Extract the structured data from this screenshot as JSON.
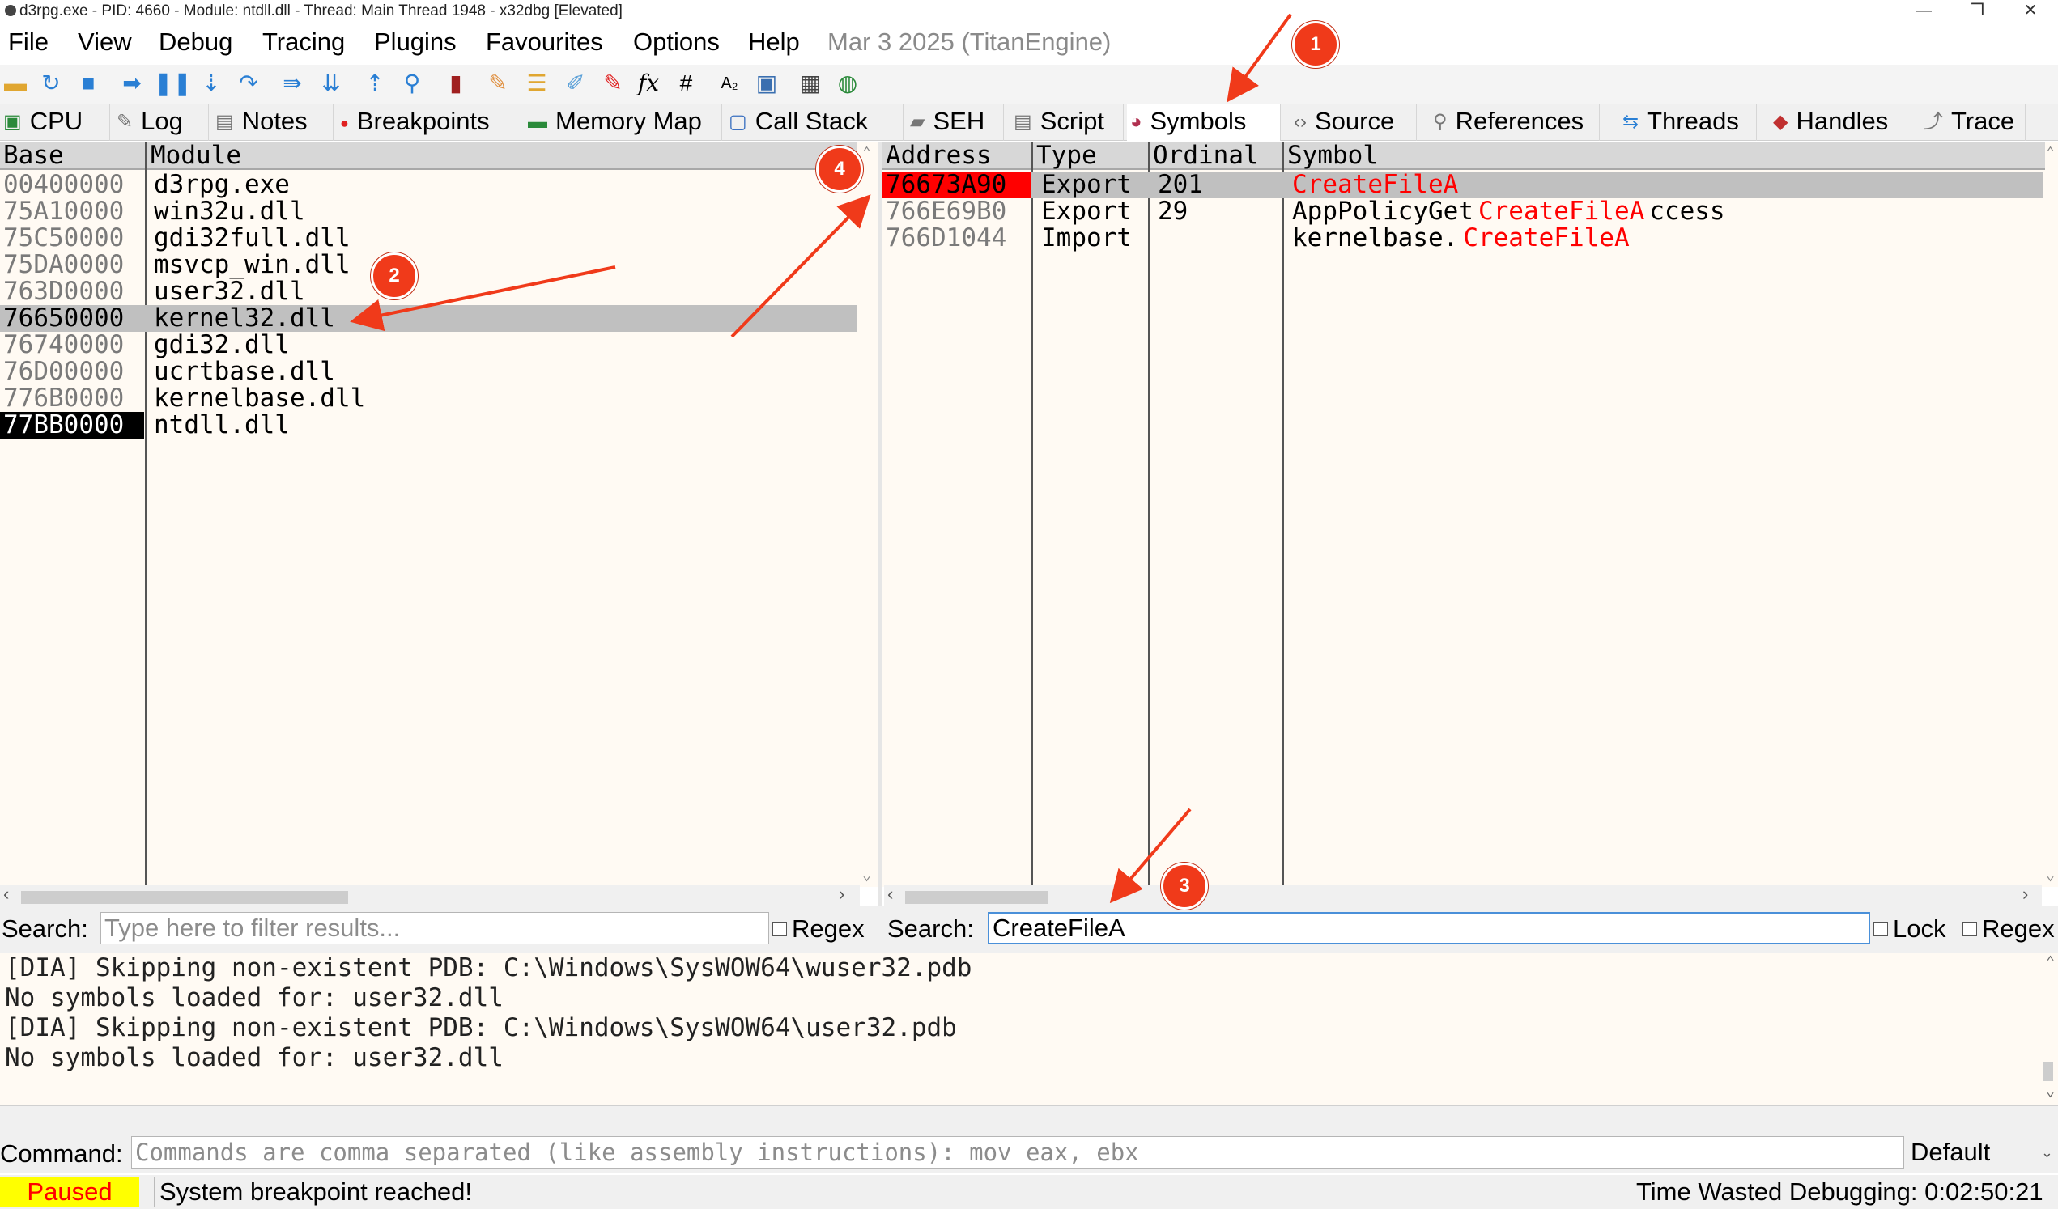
{
  "window": {
    "title": "d3rpg.exe - PID: 4660 - Module: ntdll.dll - Thread: Main Thread 1948 - x32dbg [Elevated]",
    "controls": {
      "minimize": "—",
      "restore": "❐",
      "close": "✕"
    }
  },
  "menu": {
    "items": [
      "File",
      "View",
      "Debug",
      "Tracing",
      "Plugins",
      "Favourites",
      "Options",
      "Help"
    ],
    "date": "Mar 3 2025 (TitanEngine)"
  },
  "toolbar": {
    "icons": [
      "open-icon",
      "restart-icon",
      "stop-icon",
      "run-icon",
      "pause-icon",
      "step-into-icon",
      "step-over-icon",
      "trace-into-icon",
      "trace-over-icon",
      "execute-till-return-icon",
      "run-to-user-code-icon",
      "scylla-icon",
      "patch-icon",
      "comments-icon",
      "labels-icon",
      "bookmarks-icon",
      "functions-icon",
      "hash-icon",
      "font-icon",
      "memory-icon",
      "calculator-icon",
      "globe-icon"
    ],
    "function_glyph": "fx",
    "hash_glyph": "#",
    "font_glyph": "A₂"
  },
  "tabs": [
    {
      "label": "CPU",
      "icon": "cpu-icon",
      "active": false
    },
    {
      "label": "Log",
      "icon": "log-icon",
      "active": false
    },
    {
      "label": "Notes",
      "icon": "notes-icon",
      "active": false
    },
    {
      "label": "Breakpoints",
      "icon": "breakpoint-dot-icon",
      "active": false
    },
    {
      "label": "Memory Map",
      "icon": "memory-map-icon",
      "active": false
    },
    {
      "label": "Call Stack",
      "icon": "call-stack-icon",
      "active": false
    },
    {
      "label": "SEH",
      "icon": "seh-icon",
      "active": false
    },
    {
      "label": "Script",
      "icon": "script-icon",
      "active": false
    },
    {
      "label": "Symbols",
      "icon": "symbols-icon",
      "active": true
    },
    {
      "label": "Source",
      "icon": "source-icon",
      "active": false
    },
    {
      "label": "References",
      "icon": "references-icon",
      "active": false
    },
    {
      "label": "Threads",
      "icon": "threads-icon",
      "active": false
    },
    {
      "label": "Handles",
      "icon": "handles-icon",
      "active": false
    },
    {
      "label": "Trace",
      "icon": "trace-icon",
      "active": false
    }
  ],
  "modules": {
    "headers": {
      "base": "Base",
      "module": "Module"
    },
    "rows": [
      {
        "base": "00400000",
        "module": "d3rpg.exe"
      },
      {
        "base": "75A10000",
        "module": "win32u.dll"
      },
      {
        "base": "75C50000",
        "module": "gdi32full.dll"
      },
      {
        "base": "75DA0000",
        "module": "msvcp_win.dll"
      },
      {
        "base": "763D0000",
        "module": "user32.dll"
      },
      {
        "base": "76650000",
        "module": "kernel32.dll"
      },
      {
        "base": "76740000",
        "module": "gdi32.dll"
      },
      {
        "base": "76D00000",
        "module": "ucrtbase.dll"
      },
      {
        "base": "776B0000",
        "module": "kernelbase.dll"
      },
      {
        "base": "77BB0000",
        "module": "ntdll.dll"
      }
    ],
    "selected_row": "kernel32.dll",
    "current_row": "ntdll.dll",
    "search": {
      "label": "Search:",
      "value": "",
      "placeholder": "Type here to filter results...",
      "regex_label": "Regex"
    }
  },
  "symbols": {
    "headers": {
      "address": "Address",
      "type": "Type",
      "ordinal": "Ordinal",
      "symbol": "Symbol"
    },
    "rows": [
      {
        "address": "76673A90",
        "type": "Export",
        "ordinal": "201",
        "prefix": "",
        "match": "CreateFileA",
        "suffix": ""
      },
      {
        "address": "766E69B0",
        "type": "Export",
        "ordinal": "29",
        "prefix": "AppPolicyGet",
        "match": "CreateFileA",
        "suffix": "ccess"
      },
      {
        "address": "766D1044",
        "type": "Import",
        "ordinal": "",
        "prefix": "kernelbase.",
        "match": "CreateFileA",
        "suffix": ""
      }
    ],
    "search": {
      "label": "Search:",
      "value": "CreateFileA",
      "lock_label": "Lock",
      "regex_label": "Regex"
    }
  },
  "log": {
    "lines": [
      "[DIA] Skipping non-existent PDB: C:\\Windows\\SysWOW64\\wuser32.pdb",
      "No symbols loaded for: user32.dll",
      "[DIA] Skipping non-existent PDB: C:\\Windows\\SysWOW64\\user32.pdb",
      "No symbols loaded for: user32.dll"
    ]
  },
  "command": {
    "label": "Command:",
    "placeholder": "Commands are comma separated (like assembly instructions): mov eax, ebx",
    "mode": "Default"
  },
  "status": {
    "state": "Paused",
    "message": "System breakpoint reached!",
    "time_wasted": "Time Wasted Debugging: 0:02:50:21"
  },
  "annotations": [
    "1",
    "2",
    "3",
    "4"
  ],
  "colors": {
    "accent_red": "#f03a1a",
    "paused_bg": "#ffff00",
    "paused_fg": "#ff0000",
    "match_text": "#ff0000",
    "selected_address_bg": "#ff0000",
    "current_address_bg": "#000000",
    "selection_row_bg": "#c0c0c0",
    "list_bg": "#fffaf3"
  }
}
